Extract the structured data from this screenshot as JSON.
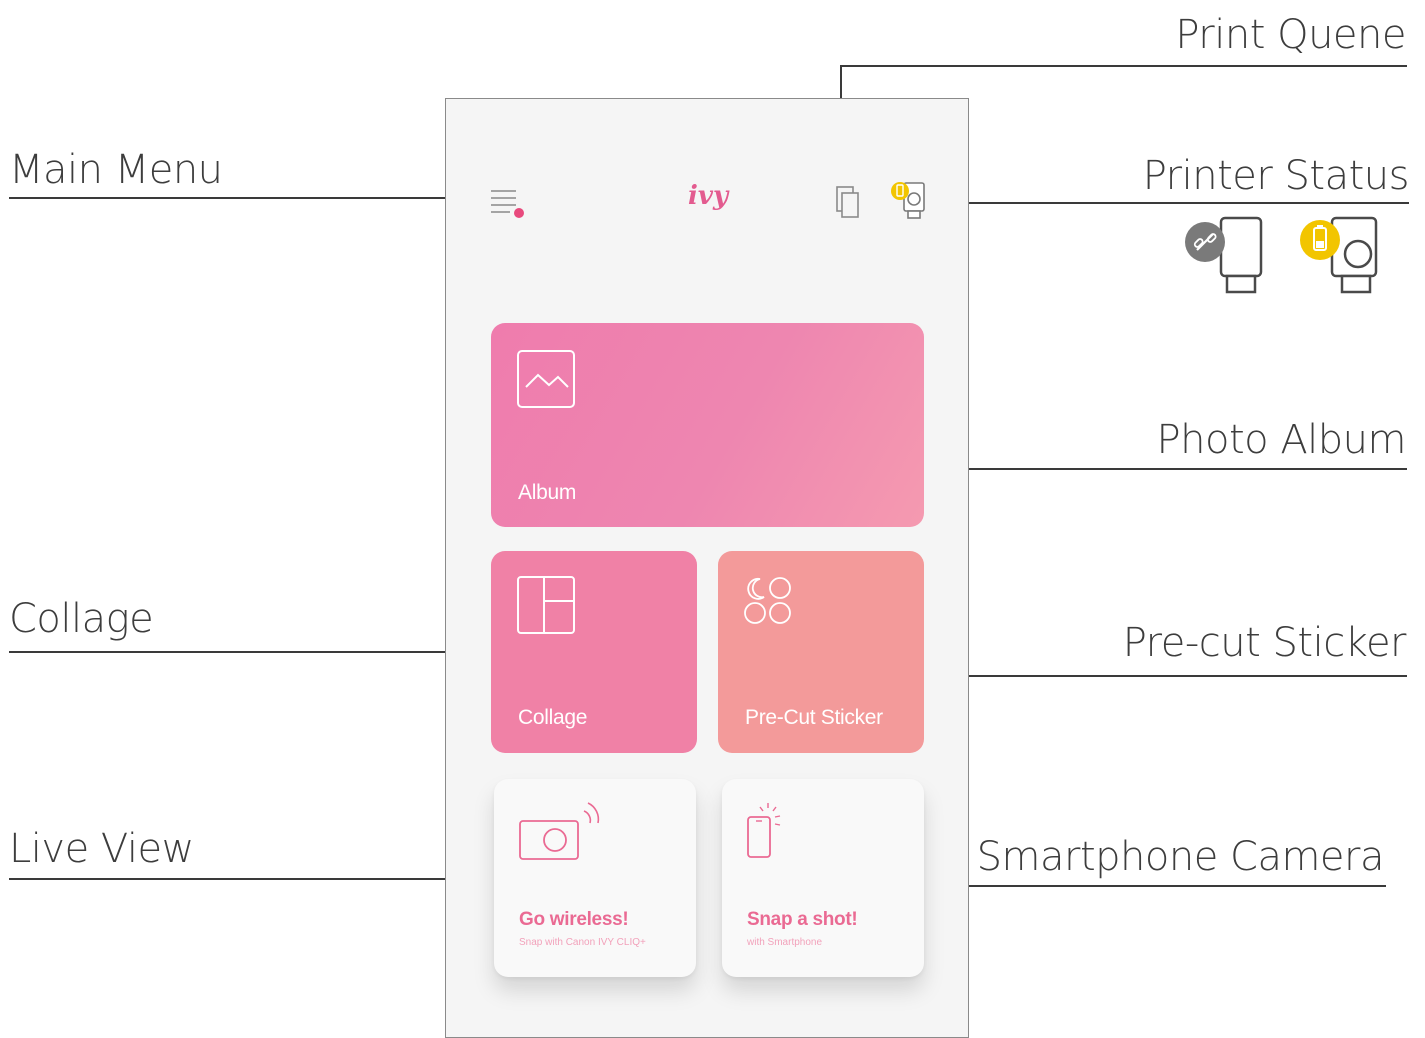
{
  "callouts": {
    "print_queue": "Print Quene",
    "main_menu": "Main Menu",
    "printer_status": "Printer Status",
    "photo_album": "Photo Album",
    "collage": "Collage",
    "pre_cut_sticker": "Pre-cut Sticker",
    "live_view": "Live View",
    "smartphone_camera": "Smartphone Camera"
  },
  "app": {
    "logo": "ivy",
    "menu_icon": "hamburger-menu-icon",
    "queue_icon": "print-queue-icon",
    "status_icon": "printer-status-icon"
  },
  "tiles": {
    "album": {
      "label": "Album",
      "icon": "image-icon"
    },
    "collage": {
      "label": "Collage",
      "icon": "collage-layout-icon"
    },
    "sticker": {
      "label": "Pre-Cut Sticker",
      "icon": "sticker-circles-icon"
    },
    "live": {
      "title": "Go wireless!",
      "subtitle": "Snap with Canon IVY CLIQ+",
      "icon": "wireless-camera-icon"
    },
    "snap": {
      "title": "Snap a shot!",
      "subtitle": "with Smartphone",
      "icon": "smartphone-icon"
    }
  },
  "status_examples": [
    {
      "name": "disconnected",
      "icon": "printer-disconnected-icon",
      "badge_color": "#8a8a8a"
    },
    {
      "name": "low-battery",
      "icon": "printer-low-battery-icon",
      "badge_color": "#f2c500"
    }
  ],
  "colors": {
    "accent": "#e35b8f",
    "album_pink": "#ef7cad",
    "collage_pink": "#f081a6",
    "sticker_salmon": "#f39a9a",
    "status_yellow": "#f2c500"
  }
}
